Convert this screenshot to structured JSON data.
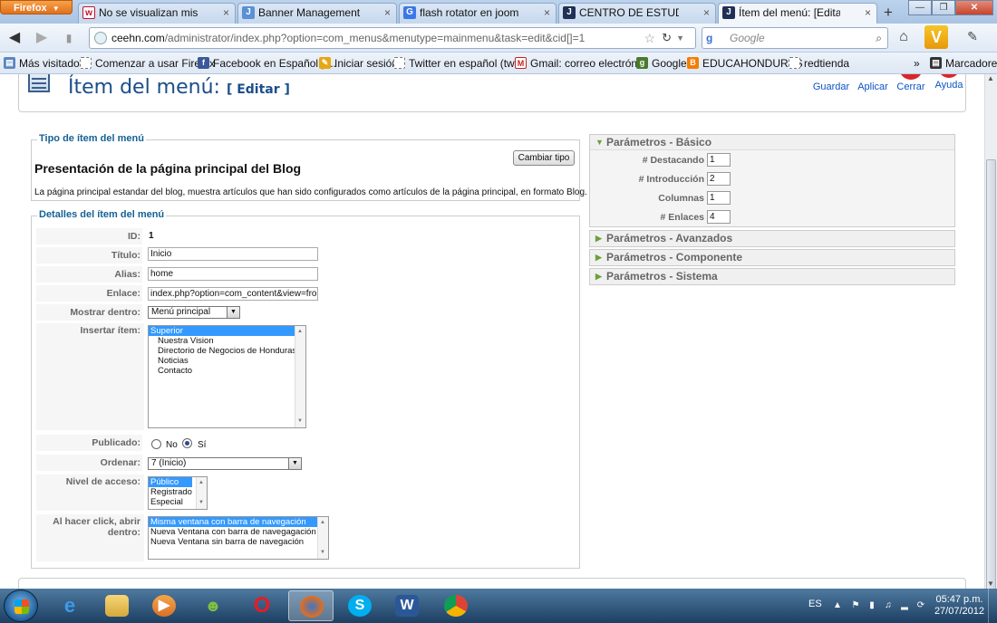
{
  "browser": {
    "app_button": "Firefox",
    "tabs": [
      {
        "title": "No se visualizan mis articulo...",
        "fav": "w",
        "fav_color": "#c8102e"
      },
      {
        "title": "Banner Management - Joom...",
        "fav": "J",
        "fav_color": "#5b8fd6"
      },
      {
        "title": "flash rotator en joomla - Bus...",
        "fav": "G",
        "fav_color": "#3b78e7"
      },
      {
        "title": "CENTRO DE ESTUDIOS Y EST...",
        "fav": "J",
        "fav_color": "#1f2f55"
      },
      {
        "title": "Ítem del menú: [Editar]",
        "fav": "J",
        "fav_color": "#1f2f55"
      }
    ],
    "url_host": "ceehn.com",
    "url_path": "/administrator/index.php?option=com_menus&menutype=mainmenu&task=edit&cid[]=1",
    "search_placeholder": "Google",
    "bookmarks": [
      "Más visitados",
      "Comenzar a usar Firefox",
      "Facebook en Español | ...",
      "Iniciar sesión",
      "Twitter en español (twi...",
      "Gmail: correo electróni...",
      "Google",
      "EDUCAHONDURAS",
      "redtienda"
    ],
    "bookmarks_menu": "Marcadores"
  },
  "header": {
    "title": "Ítem del menú:",
    "subtitle": "[ Editar ]",
    "buttons": {
      "save": "Guardar",
      "apply": "Aplicar",
      "close": "Cerrar",
      "help": "Ayuda"
    }
  },
  "type_section": {
    "legend": "Tipo de ítem del menú",
    "title": "Presentación de la página principal del Blog",
    "description": "La página principal estandar del blog, muestra artículos que han sido configurados como artículos de la página principal, en formato Blog.",
    "change_button": "Cambiar tipo"
  },
  "details": {
    "legend": "Detalles del ítem del menú",
    "labels": {
      "id": "ID:",
      "title": "Título:",
      "alias": "Alias:",
      "link": "Enlace:",
      "menu": "Mostrar dentro:",
      "parent": "Insertar ítem:",
      "published": "Publicado:",
      "order": "Ordenar:",
      "access": "Nivel de acceso:",
      "target": "Al hacer click, abrir dentro:"
    },
    "id": "1",
    "title": "Inicio",
    "alias": "home",
    "link": "index.php?option=com_content&view=frontpage",
    "menu": "Menú principal",
    "parent_options": [
      "Superior",
      "Nuestra Vision",
      "Directorio de Negocios de Honduras",
      "Noticias",
      "Contacto"
    ],
    "published_no": "No",
    "published_yes": "Sí",
    "published": "yes",
    "order": "7 (Inicio)",
    "access_options": [
      "Público",
      "Registrado",
      "Especial"
    ],
    "target_options": [
      "Misma ventana con barra de navegación",
      "Nueva Ventana con barra de navegagación",
      "Nueva Ventana sin barra de navegación"
    ]
  },
  "params": {
    "basic_title": "Parámetros - Básico",
    "basic": [
      {
        "label": "# Destacando",
        "value": "1"
      },
      {
        "label": "# Introducción",
        "value": "2"
      },
      {
        "label": "Columnas",
        "value": "1"
      },
      {
        "label": "# Enlaces",
        "value": "4"
      }
    ],
    "advanced_title": "Parámetros - Avanzados",
    "component_title": "Parámetros - Componente",
    "system_title": "Parámetros - Sistema"
  },
  "taskbar": {
    "lang": "ES",
    "time": "05:47 p.m.",
    "date": "27/07/2012"
  }
}
